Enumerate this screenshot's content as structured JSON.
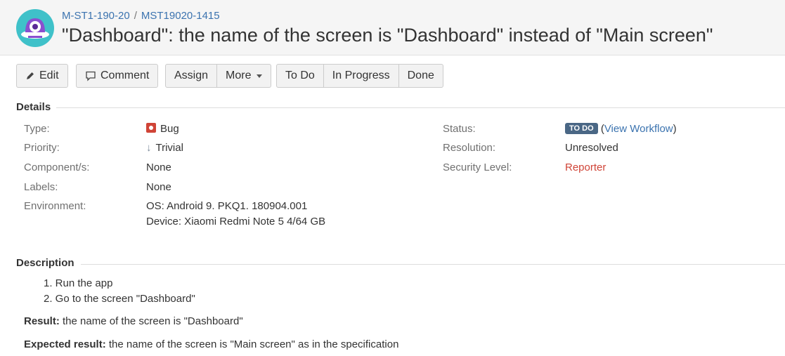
{
  "breadcrumb": {
    "project": "M-ST1-190-20",
    "separator": "/",
    "issue_key": "MST19020-1415"
  },
  "title": "\"Dashboard\": the name of the screen is \"Dashboard\" instead of \"Main screen\"",
  "toolbar": {
    "edit": "Edit",
    "comment": "Comment",
    "assign": "Assign",
    "more": "More",
    "todo": "To Do",
    "in_progress": "In Progress",
    "done": "Done"
  },
  "details": {
    "heading": "Details",
    "type_label": "Type:",
    "type_value": "Bug",
    "priority_label": "Priority:",
    "priority_value": "Trivial",
    "components_label": "Component/s:",
    "components_value": "None",
    "labels_label": "Labels:",
    "labels_value": "None",
    "environment_label": "Environment:",
    "environment_line1": "OS: Android 9. PKQ1. 180904.001",
    "environment_line2": "Device: Xiaomi Redmi Note 5 4/64 GB",
    "status_label": "Status:",
    "status_value": "TO DO",
    "view_workflow": "View Workflow",
    "resolution_label": "Resolution:",
    "resolution_value": "Unresolved",
    "security_label": "Security Level:",
    "security_value": "Reporter"
  },
  "description": {
    "heading": "Description",
    "steps": [
      "1. Run the app",
      "2. Go to the screen \"Dashboard\""
    ],
    "result_label": "Result:",
    "result_text": " the name of the screen is \"Dashboard\"",
    "expected_label": "Expected result:",
    "expected_text": " the name of the screen is \"Main screen\" as in the specification"
  },
  "colors": {
    "link": "#3b73af",
    "bug": "#d04437",
    "status_lozenge": "#4a6785",
    "security": "#d04437"
  }
}
